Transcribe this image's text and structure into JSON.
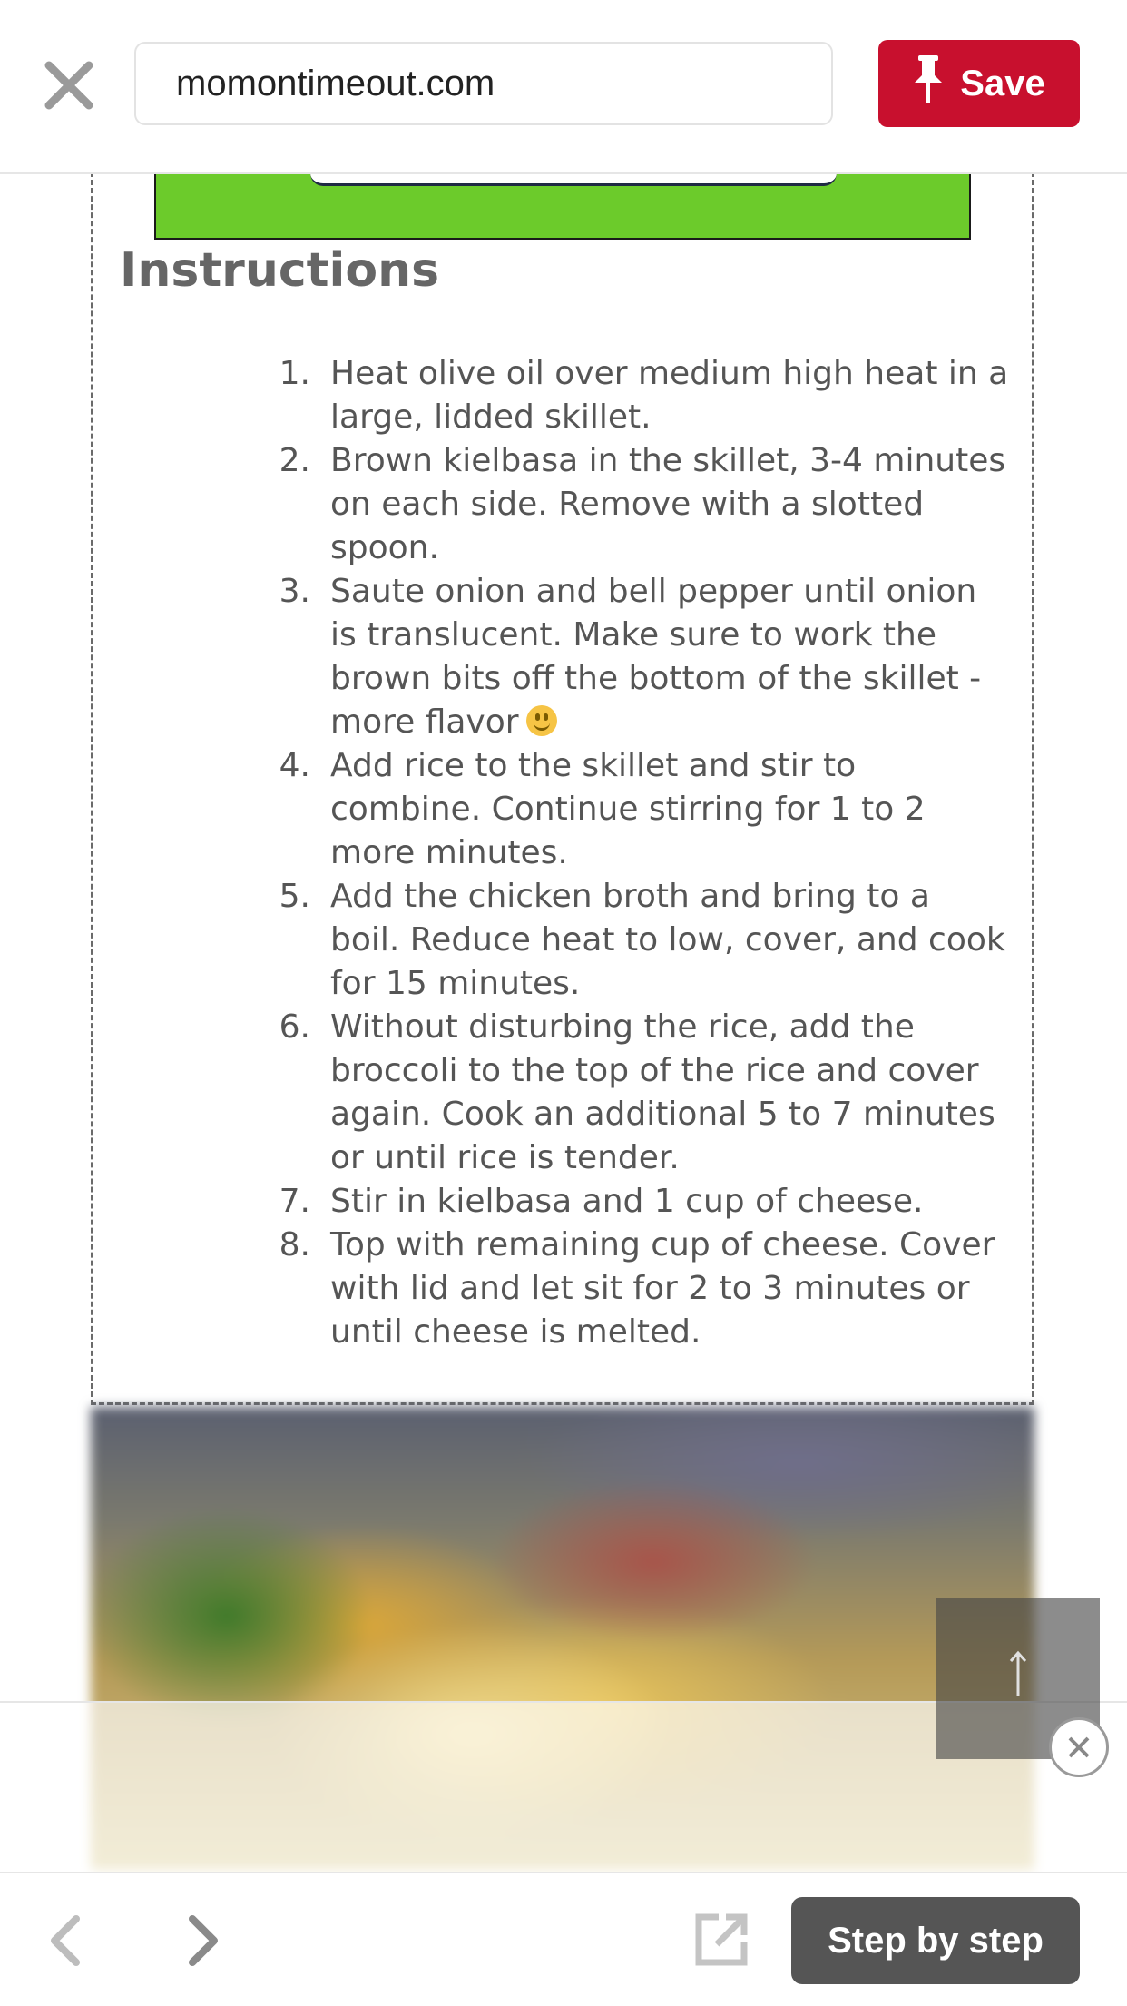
{
  "topbar": {
    "url": "momontimeout.com",
    "save_label": "Save"
  },
  "content": {
    "heading": "Instructions",
    "steps": [
      {
        "num": "1.",
        "text": "Heat olive oil over medium high heat in a large, lidded skillet."
      },
      {
        "num": "2.",
        "text": "Brown kielbasa in the skillet, 3-4 minutes on each side. Remove with a slotted spoon."
      },
      {
        "num": "3.",
        "text": "Saute onion and bell pepper until onion is translucent. Make sure to work the brown bits off the bottom of the skillet - more flavor"
      },
      {
        "num": "4.",
        "text": "Add rice to the skillet and stir to combine. Continue stirring for 1 to 2 more minutes."
      },
      {
        "num": "5.",
        "text": "Add the chicken broth and bring to a boil. Reduce heat to low, cover, and cook for 15 minutes."
      },
      {
        "num": "6.",
        "text": "Without disturbing the rice, add the broccoli to the top of the rice and cover again. Cook an additional 5 to 7 minutes or until rice is tender."
      },
      {
        "num": "7.",
        "text": "Stir in kielbasa and 1 cup of cheese."
      },
      {
        "num": "8.",
        "text": "Top with remaining cup of cheese. Cover with lid and let sit for 2 to 3 minutes or until cheese is melted."
      }
    ]
  },
  "bottombar": {
    "step_label": "Step by step"
  },
  "icons": {
    "close": "close-icon",
    "pin": "pin-icon",
    "back": "chevron-left-icon",
    "forward": "chevron-right-icon",
    "share": "external-link-icon",
    "scroll_top": "arrow-up-icon",
    "smiley": "smiley-icon"
  },
  "colors": {
    "save_red": "#c8102e",
    "banner_green": "#6ccb2b",
    "step_button": "#555555"
  }
}
